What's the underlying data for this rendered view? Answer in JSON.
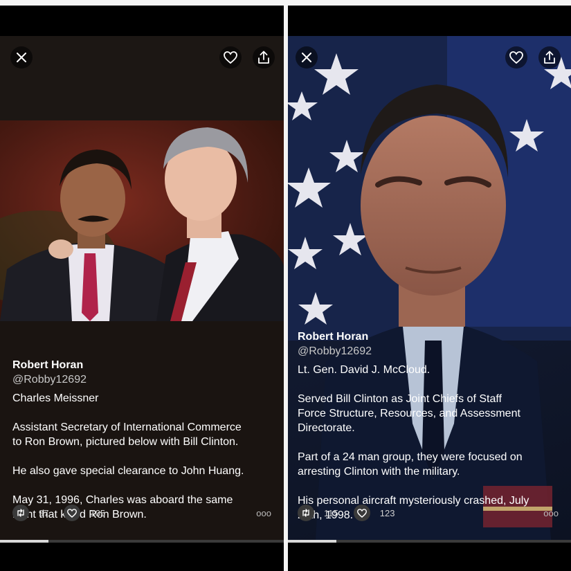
{
  "panels": [
    {
      "author": {
        "name": "Robert Horan",
        "handle": "@Robby12692"
      },
      "subtitle": "Charles Meissner",
      "paragraphs": [
        "Assistant Secretary of International Commerce\nto Ron Brown, pictured below with Bill Clinton.",
        "He also gave special clearance to John Huang.",
        "May 31, 1996, Charles was aboard the same\nflight that killed Ron Brown."
      ],
      "stats": {
        "retweets": "97",
        "likes": "105"
      },
      "progress": 0.17,
      "icons": {
        "close": "close-icon",
        "like": "heart-icon",
        "share": "share-icon",
        "retweet": "retweet-icon",
        "more": "more-icon"
      }
    },
    {
      "author": {
        "name": "Robert Horan",
        "handle": "@Robby12692"
      },
      "subtitle": "Lt. Gen. David J. McCloud.",
      "paragraphs": [
        "Served Bill Clinton as Joint Chiefs of Staff\nForce Structure, Resources, and Assessment\nDirectorate.",
        "Part of a 24 man group, they were focused on\narresting Clinton with the military.",
        "His personal aircraft mysteriously crashed, July\n26th, 1998."
      ],
      "stats": {
        "retweets": "115",
        "likes": "123"
      },
      "progress": 0.17,
      "icons": {
        "close": "close-icon",
        "like": "heart-icon",
        "share": "share-icon",
        "retweet": "retweet-icon",
        "more": "more-icon"
      }
    }
  ],
  "more_label": "ooo",
  "colors": {
    "background": "#000000",
    "divider": "#f4f4f4",
    "text": "#ffffff",
    "handle": "#c8c8c8"
  }
}
